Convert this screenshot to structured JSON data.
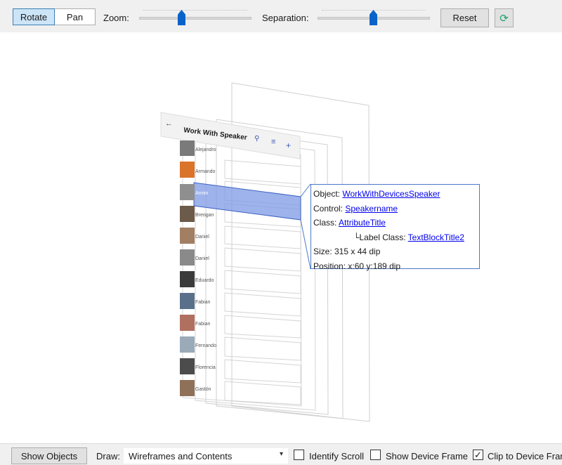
{
  "toolbar": {
    "rotate_label": "Rotate",
    "pan_label": "Pan",
    "zoom_label": "Zoom:",
    "separation_label": "Separation:",
    "reset_label": "Reset",
    "refresh_icon": "refresh-icon"
  },
  "app": {
    "title": "Work With Speaker",
    "icons": [
      "back-arrow-icon",
      "search-icon",
      "filter-icon",
      "add-icon"
    ],
    "speakers": [
      "Alejandro",
      "Armando",
      "Armin",
      "Breogan",
      "Daniel",
      "Daniel",
      "Eduardo",
      "Fabian",
      "Fabian",
      "Fernando",
      "Florencia",
      "Gastón"
    ]
  },
  "tooltip": {
    "object_label": "Object:",
    "object_value": "WorkWithDevicesSpeaker",
    "control_label": "Control:",
    "control_value": "Speakername",
    "class_label": "Class:",
    "class_value": "AttributeTitle",
    "label_class_label": "└Label Class:",
    "label_class_value": "TextBlockTitle2",
    "size": "Size: 315 x 44 dip",
    "position": "Position: x:60 y:189 dip"
  },
  "bottom": {
    "show_objects": "Show Objects",
    "draw_label": "Draw:",
    "draw_value": "Wireframes and Contents",
    "identify_scroll": "Identify Scroll",
    "show_device_frame": "Show Device Frame",
    "clip_to_device_frame": "Clip to Device Frame",
    "identify_scroll_checked": false,
    "show_device_frame_checked": false,
    "clip_checked": true
  },
  "colors": {
    "accent": "#0a63c9",
    "selection": "#7d9ae6",
    "tooltip_border": "#4a78c8"
  }
}
